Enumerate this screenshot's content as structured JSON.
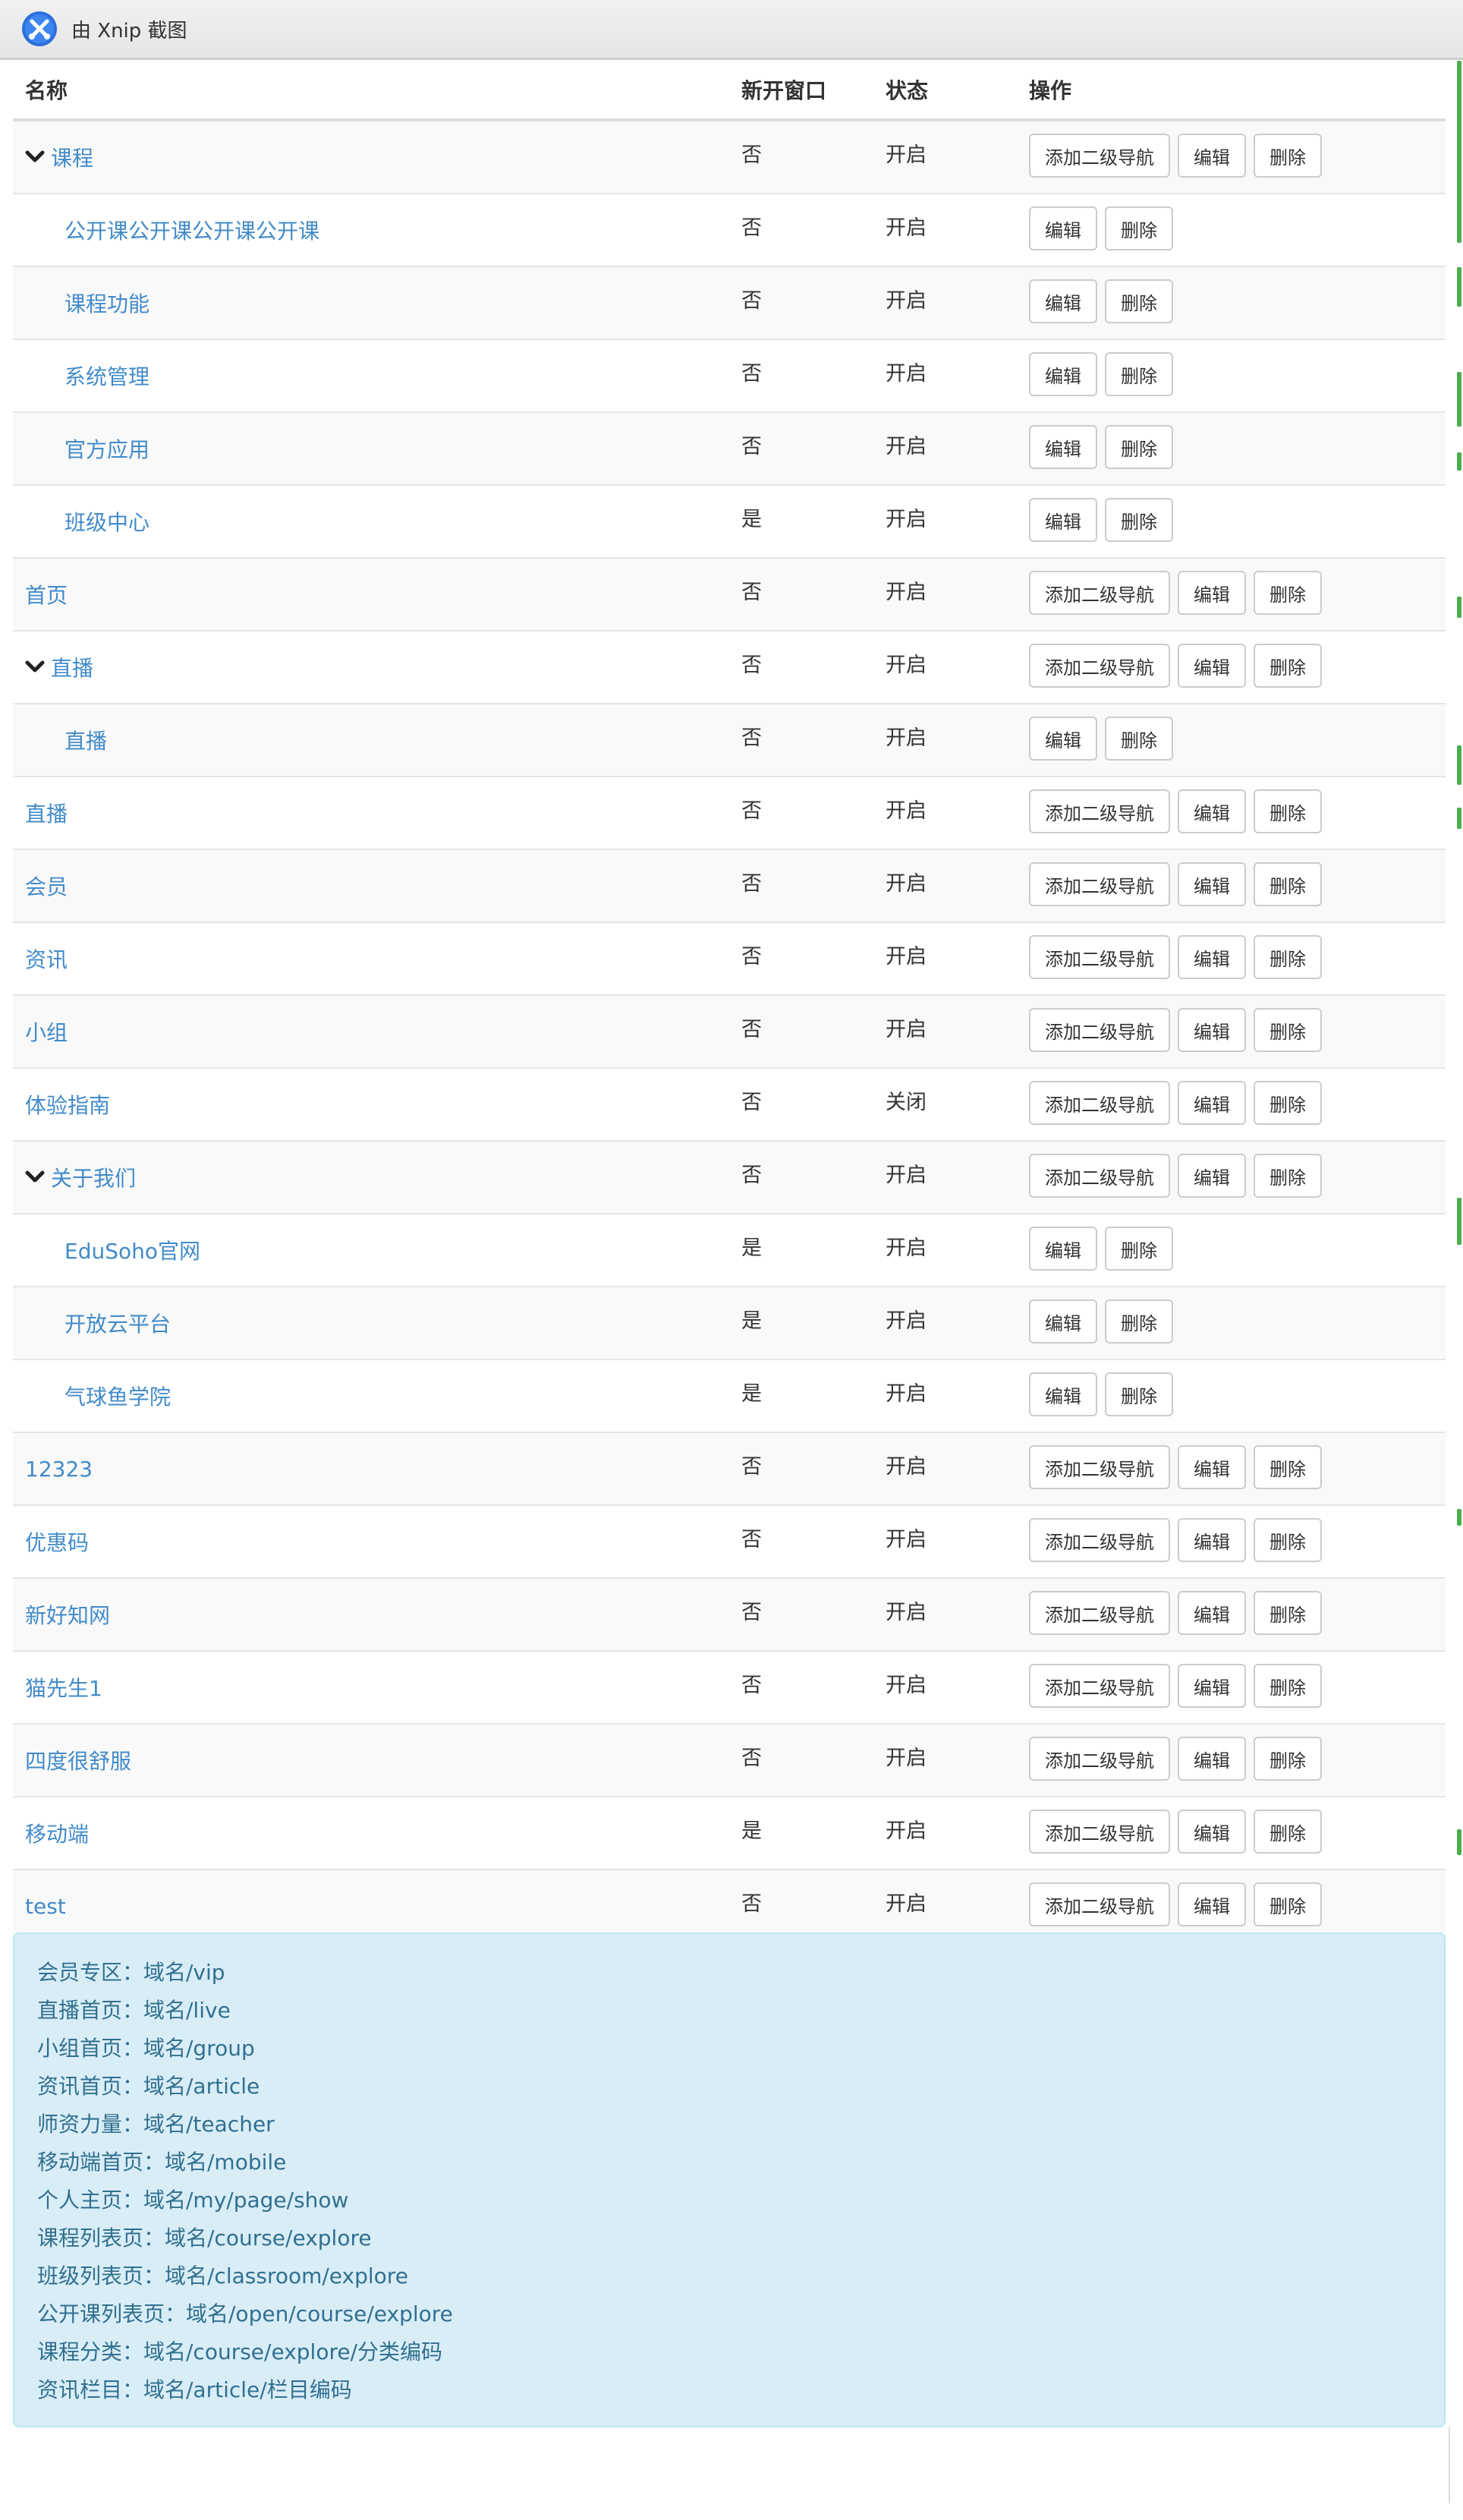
{
  "app": {
    "title": "由 Xnip 截图"
  },
  "table": {
    "headers": {
      "name": "名称",
      "new_window": "新开窗口",
      "status": "状态",
      "actions": "操作"
    },
    "rows": [
      {
        "name": "课程",
        "level": 1,
        "expandable": true,
        "new_window": "否",
        "status": "开启",
        "actions": [
          "添加二级导航",
          "编辑",
          "删除"
        ]
      },
      {
        "name": "公开课公开课公开课公开课",
        "level": 2,
        "expandable": false,
        "new_window": "否",
        "status": "开启",
        "actions": [
          "编辑",
          "删除"
        ]
      },
      {
        "name": "课程功能",
        "level": 2,
        "expandable": false,
        "new_window": "否",
        "status": "开启",
        "actions": [
          "编辑",
          "删除"
        ]
      },
      {
        "name": "系统管理",
        "level": 2,
        "expandable": false,
        "new_window": "否",
        "status": "开启",
        "actions": [
          "编辑",
          "删除"
        ]
      },
      {
        "name": "官方应用",
        "level": 2,
        "expandable": false,
        "new_window": "否",
        "status": "开启",
        "actions": [
          "编辑",
          "删除"
        ]
      },
      {
        "name": "班级中心",
        "level": 2,
        "expandable": false,
        "new_window": "是",
        "status": "开启",
        "actions": [
          "编辑",
          "删除"
        ]
      },
      {
        "name": "首页",
        "level": 1,
        "expandable": false,
        "new_window": "否",
        "status": "开启",
        "actions": [
          "添加二级导航",
          "编辑",
          "删除"
        ]
      },
      {
        "name": "直播",
        "level": 1,
        "expandable": true,
        "new_window": "否",
        "status": "开启",
        "actions": [
          "添加二级导航",
          "编辑",
          "删除"
        ]
      },
      {
        "name": "直播",
        "level": 2,
        "expandable": false,
        "new_window": "否",
        "status": "开启",
        "actions": [
          "编辑",
          "删除"
        ]
      },
      {
        "name": "直播",
        "level": 1,
        "expandable": false,
        "new_window": "否",
        "status": "开启",
        "actions": [
          "添加二级导航",
          "编辑",
          "删除"
        ]
      },
      {
        "name": "会员",
        "level": 1,
        "expandable": false,
        "new_window": "否",
        "status": "开启",
        "actions": [
          "添加二级导航",
          "编辑",
          "删除"
        ]
      },
      {
        "name": "资讯",
        "level": 1,
        "expandable": false,
        "new_window": "否",
        "status": "开启",
        "actions": [
          "添加二级导航",
          "编辑",
          "删除"
        ]
      },
      {
        "name": "小组",
        "level": 1,
        "expandable": false,
        "new_window": "否",
        "status": "开启",
        "actions": [
          "添加二级导航",
          "编辑",
          "删除"
        ]
      },
      {
        "name": "体验指南",
        "level": 1,
        "expandable": false,
        "new_window": "否",
        "status": "关闭",
        "actions": [
          "添加二级导航",
          "编辑",
          "删除"
        ]
      },
      {
        "name": "关于我们",
        "level": 1,
        "expandable": true,
        "new_window": "否",
        "status": "开启",
        "actions": [
          "添加二级导航",
          "编辑",
          "删除"
        ]
      },
      {
        "name": "EduSoho官网",
        "level": 2,
        "expandable": false,
        "new_window": "是",
        "status": "开启",
        "actions": [
          "编辑",
          "删除"
        ]
      },
      {
        "name": "开放云平台",
        "level": 2,
        "expandable": false,
        "new_window": "是",
        "status": "开启",
        "actions": [
          "编辑",
          "删除"
        ]
      },
      {
        "name": "气球鱼学院",
        "level": 2,
        "expandable": false,
        "new_window": "是",
        "status": "开启",
        "actions": [
          "编辑",
          "删除"
        ]
      },
      {
        "name": "12323",
        "level": 1,
        "expandable": false,
        "new_window": "否",
        "status": "开启",
        "actions": [
          "添加二级导航",
          "编辑",
          "删除"
        ]
      },
      {
        "name": "优惠码",
        "level": 1,
        "expandable": false,
        "new_window": "否",
        "status": "开启",
        "actions": [
          "添加二级导航",
          "编辑",
          "删除"
        ]
      },
      {
        "name": "新好知网",
        "level": 1,
        "expandable": false,
        "new_window": "否",
        "status": "开启",
        "actions": [
          "添加二级导航",
          "编辑",
          "删除"
        ]
      },
      {
        "name": "猫先生1",
        "level": 1,
        "expandable": false,
        "new_window": "否",
        "status": "开启",
        "actions": [
          "添加二级导航",
          "编辑",
          "删除"
        ]
      },
      {
        "name": "四度很舒服",
        "level": 1,
        "expandable": false,
        "new_window": "否",
        "status": "开启",
        "actions": [
          "添加二级导航",
          "编辑",
          "删除"
        ]
      },
      {
        "name": "移动端",
        "level": 1,
        "expandable": false,
        "new_window": "是",
        "status": "开启",
        "actions": [
          "添加二级导航",
          "编辑",
          "删除"
        ]
      },
      {
        "name": "test",
        "level": 1,
        "expandable": false,
        "new_window": "否",
        "status": "开启",
        "actions": [
          "添加二级导航",
          "编辑",
          "删除"
        ]
      }
    ]
  },
  "info": {
    "lines": [
      "会员专区：域名/vip",
      "直播首页：域名/live",
      "小组首页：域名/group",
      "资讯首页：域名/article",
      "师资力量：域名/teacher",
      "移动端首页：域名/mobile",
      "个人主页：域名/my/page/show",
      "课程列表页：域名/course/explore",
      "班级列表页：域名/classroom/explore",
      "公开课列表页：域名/open/course/explore",
      "课程分类：域名/course/explore/分类编码",
      "资讯栏目：域名/article/栏目编码"
    ]
  },
  "colors": {
    "link": "#428bca",
    "info_bg": "#d9edf7",
    "info_text": "#31708f",
    "stripe": "#f9f9f9"
  }
}
